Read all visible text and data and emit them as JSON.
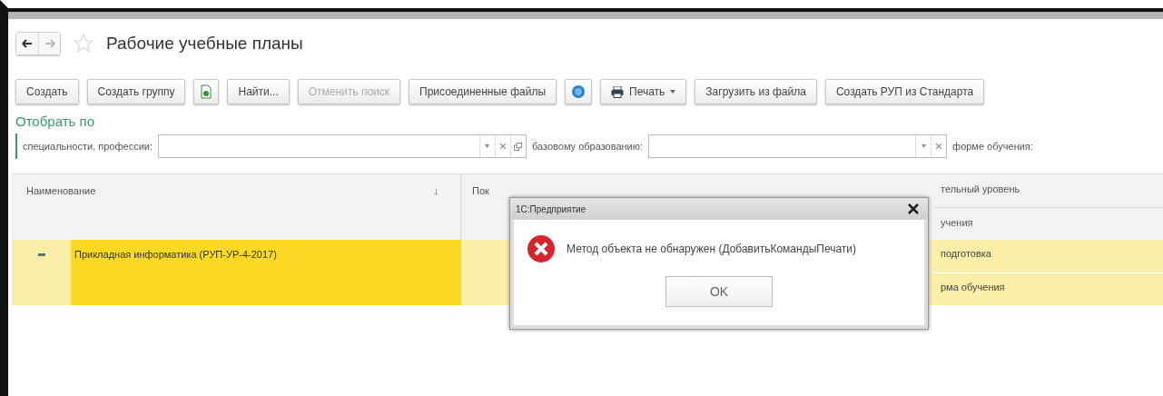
{
  "window": {
    "title": "Рабочие учебные планы"
  },
  "toolbar": [
    {
      "kind": "text",
      "label": "Создать",
      "disabled": false
    },
    {
      "kind": "text",
      "label": "Создать группу",
      "disabled": false
    },
    {
      "kind": "doc-icon"
    },
    {
      "kind": "text",
      "label": "Найти...",
      "disabled": false
    },
    {
      "kind": "text",
      "label": "Отменить поиск",
      "disabled": true
    },
    {
      "kind": "text",
      "label": "Присоединенные файлы",
      "disabled": false
    },
    {
      "kind": "globe-icon"
    },
    {
      "kind": "print",
      "label": "Печать",
      "disabled": false
    },
    {
      "kind": "text",
      "label": "Загрузить из файла",
      "disabled": false
    },
    {
      "kind": "text",
      "label": "Создать РУП из Стандарта",
      "disabled": false
    }
  ],
  "filter": {
    "heading": "Отобрать по",
    "fields": [
      {
        "label": "специальности, профессии:",
        "open_button": true
      },
      {
        "label": "базовому образованию:",
        "open_button": false
      }
    ],
    "trailing_label": "форме обучения:"
  },
  "table": {
    "columns": [
      {
        "label": "Наименование",
        "sort": "↓"
      },
      {
        "label": "Пок"
      },
      {
        "label": "тельный уровень",
        "sub_label": "учения"
      }
    ],
    "rows": [
      {
        "selected": true,
        "name": "Прикладная информатика (РУП-УР-4-2017)",
        "column_3": "подготовка",
        "column_3_sub": "рма обучения"
      }
    ]
  },
  "dialog": {
    "title": "1С:Предприятие",
    "message": "Метод объекта не обнаружен (ДобавитьКомандыПечати)",
    "button": "OK"
  }
}
